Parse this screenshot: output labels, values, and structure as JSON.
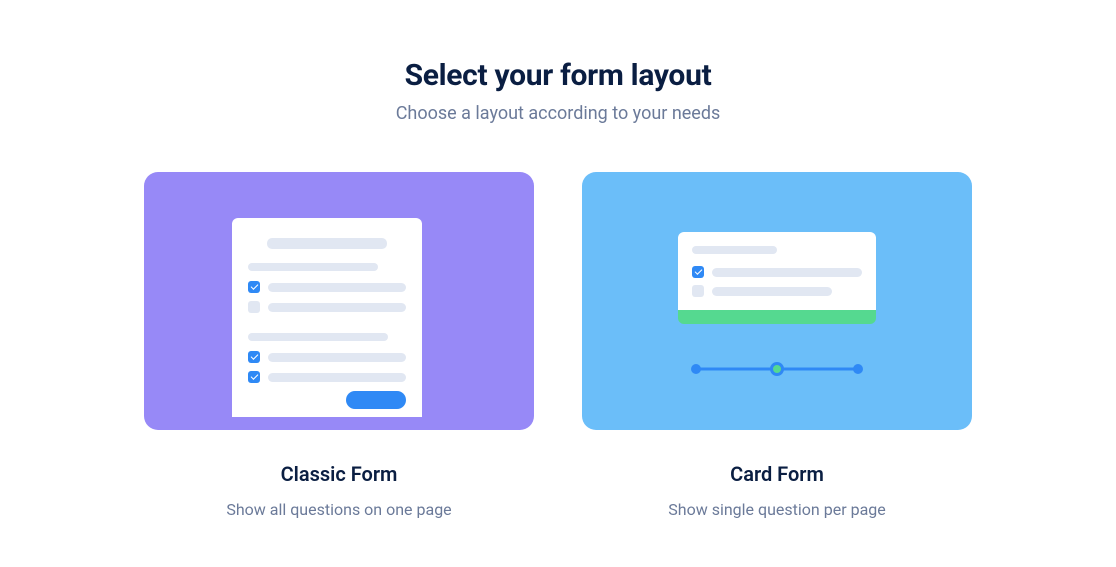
{
  "header": {
    "title": "Select your form layout",
    "subtitle": "Choose a layout according to your needs"
  },
  "options": {
    "classic": {
      "title": "Classic Form",
      "description": "Show all questions on one page"
    },
    "card": {
      "title": "Card Form",
      "description": "Show single question per page"
    }
  }
}
